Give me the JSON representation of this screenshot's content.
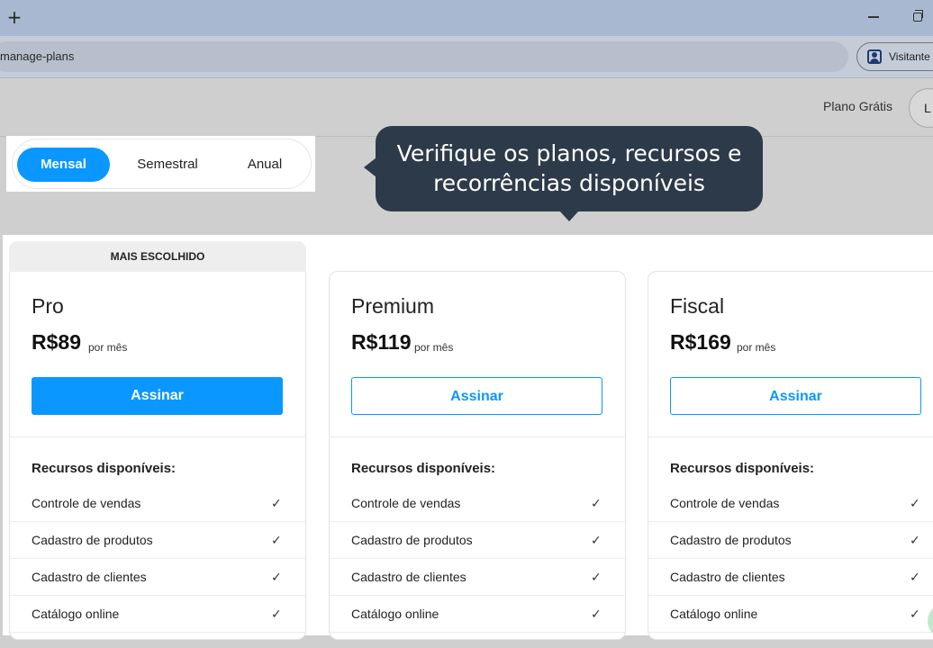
{
  "browser": {
    "new_tab_symbol": "+",
    "url": "manage-plans",
    "profile_label": "Visitante"
  },
  "header": {
    "plan_label": "Plano Grátis",
    "avatar_initial": "L"
  },
  "recurrence": {
    "options": [
      "Mensal",
      "Semestral",
      "Anual"
    ],
    "selected": "Mensal"
  },
  "tooltip": {
    "text": "Verifique os planos, recursos e recorrências disponíveis"
  },
  "plans": [
    {
      "badge": "MAIS ESCOLHIDO",
      "name": "Pro",
      "price": "R$89",
      "period": "por mês",
      "button": "Assinar",
      "features_title": "Recursos disponíveis:",
      "features": [
        "Controle de vendas",
        "Cadastro de produtos",
        "Cadastro de clientes",
        "Catálogo online"
      ]
    },
    {
      "name": "Premium",
      "price": "R$119",
      "period": "por mês",
      "button": "Assinar",
      "features_title": "Recursos disponíveis:",
      "features": [
        "Controle de vendas",
        "Cadastro de produtos",
        "Cadastro de clientes",
        "Catálogo online"
      ]
    },
    {
      "name": "Fiscal",
      "price": "R$169",
      "period": "por mês",
      "button": "Assinar",
      "features_title": "Recursos disponíveis:",
      "features": [
        "Controle de vendas",
        "Cadastro de produtos",
        "Cadastro de clientes",
        "Catálogo online"
      ]
    }
  ],
  "icons": {
    "check": "✓"
  },
  "colors": {
    "accent": "#0a97ff",
    "tooltip_bg": "#2d3a49"
  }
}
